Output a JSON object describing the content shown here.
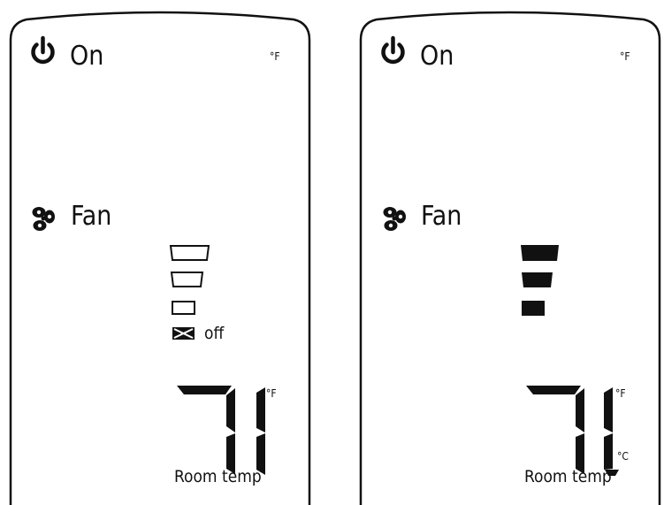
{
  "panels": [
    {
      "power_label": "On",
      "unit_top": "°F",
      "fan_label": "Fan",
      "fan_levels": [
        "high",
        "medium",
        "low",
        "off"
      ],
      "fan_selected": "none",
      "off_label": "off",
      "temperature_value": "71",
      "temp_unit_f": "°F",
      "room_temp_label": "Room temp"
    },
    {
      "power_label": "On",
      "unit_top": "°F",
      "fan_label": "Fan",
      "fan_levels": [
        "high",
        "medium",
        "low"
      ],
      "fan_selected": "all",
      "temperature_value": "71",
      "temp_unit_f": "°F",
      "temp_unit_c": "°C",
      "room_temp_label": "Room temp"
    }
  ],
  "colors": {
    "ink": "#111111",
    "background": "#ffffff"
  },
  "icons": [
    "power-icon",
    "fan-icon",
    "x-box-icon"
  ]
}
